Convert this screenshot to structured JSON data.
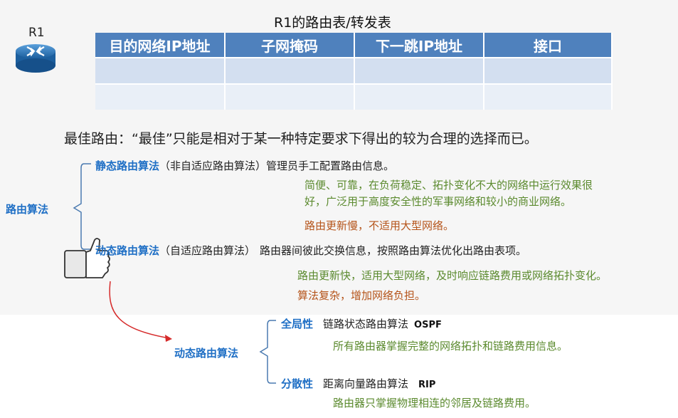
{
  "router": {
    "label": "R1"
  },
  "table": {
    "title": "R1的路由表/转发表",
    "headers": [
      "目的网络IP地址",
      "子网掩码",
      "下一跳IP地址",
      "接口"
    ]
  },
  "best_route": "最佳路由：“最佳”只能是相对于某一种特定要求下得出的较为合理的选择而已。",
  "algorithm": {
    "root": "路由算法",
    "static": {
      "name": "静态路由算法",
      "alias": "（非自适应路由算法）",
      "desc": "管理员手工配置路由信息。",
      "pro_line1": "简便、可靠，在负荷稳定、拓扑变化不大的网络中运行效果很",
      "pro_line2": "好，广泛用于高度安全性的军事网络和较小的商业网络。",
      "con": "路由更新慢，不适用大型网络。"
    },
    "dynamic": {
      "name": "动态路由算法",
      "alias": "（自适应路由算法）",
      "desc": "路由器间彼此交换信息，按照路由算法优化出路由表项。",
      "pro": "路由更新快，适用大型网络，及时响应链路费用或网络拓扑变化。",
      "con": "算法复杂，增加网络负担。"
    }
  },
  "dynamic_types": {
    "root": "动态路由算法",
    "global": {
      "name": "全局性",
      "desc": "链路状态路由算法",
      "protocol": "OSPF",
      "detail": "所有路由器掌握完整的网络拓扑和链路费用信息。"
    },
    "distributed": {
      "name": "分散性",
      "desc": "距离向量路由算法",
      "protocol": "RIP",
      "detail": "路由器只掌握物理相连的邻居及链路费用。"
    }
  },
  "colors": {
    "header_blue": "#4f81bd",
    "label_blue": "#1f6fc5",
    "pro_green": "#5b8a2e",
    "con_brown": "#b5541a",
    "arrow_red": "#d62b2b"
  },
  "icons": [
    "router-icon",
    "thumbs-up-icon"
  ]
}
